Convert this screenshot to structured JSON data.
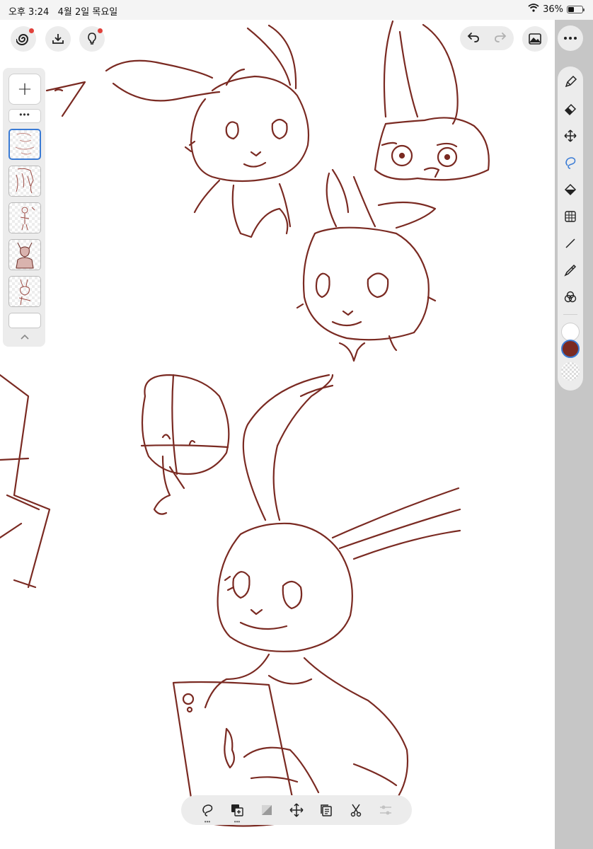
{
  "status_bar": {
    "time": "오후 3:24",
    "date": "4월 2일 목요일",
    "battery_text": "36%",
    "battery_level": 0.36
  },
  "toolbar": {
    "left_icons": [
      "spiral-logo-icon",
      "download-tray-icon",
      "lightbulb-icon"
    ],
    "right_icons": [
      "undo-icon",
      "redo-icon",
      "gallery-icon",
      "more-icon"
    ]
  },
  "layers": {
    "add_symbol": "+",
    "more_symbol": "•••",
    "thumbnails": [
      "layer-sketch-selected",
      "layer-figure",
      "layer-small-figure",
      "layer-deer-character",
      "layer-bunny"
    ]
  },
  "tools": [
    "pencil-icon",
    "eraser-icon",
    "move-icon",
    "lasso-icon",
    "fill-icon",
    "grid-icon",
    "line-icon",
    "eyedropper-icon",
    "color-wheel-icon"
  ],
  "colors": {
    "stroke": "#7a2a22",
    "primary_swatch": "#ffffff",
    "secondary_swatch": "#7a2a22",
    "accent": "#3a7bd5",
    "notification": "#e0403a"
  },
  "bottom_tools": [
    "lasso-select-icon",
    "add-layer-icon",
    "transparency-icon",
    "transform-icon",
    "duplicate-icon",
    "cut-icon",
    "adjust-icon"
  ]
}
